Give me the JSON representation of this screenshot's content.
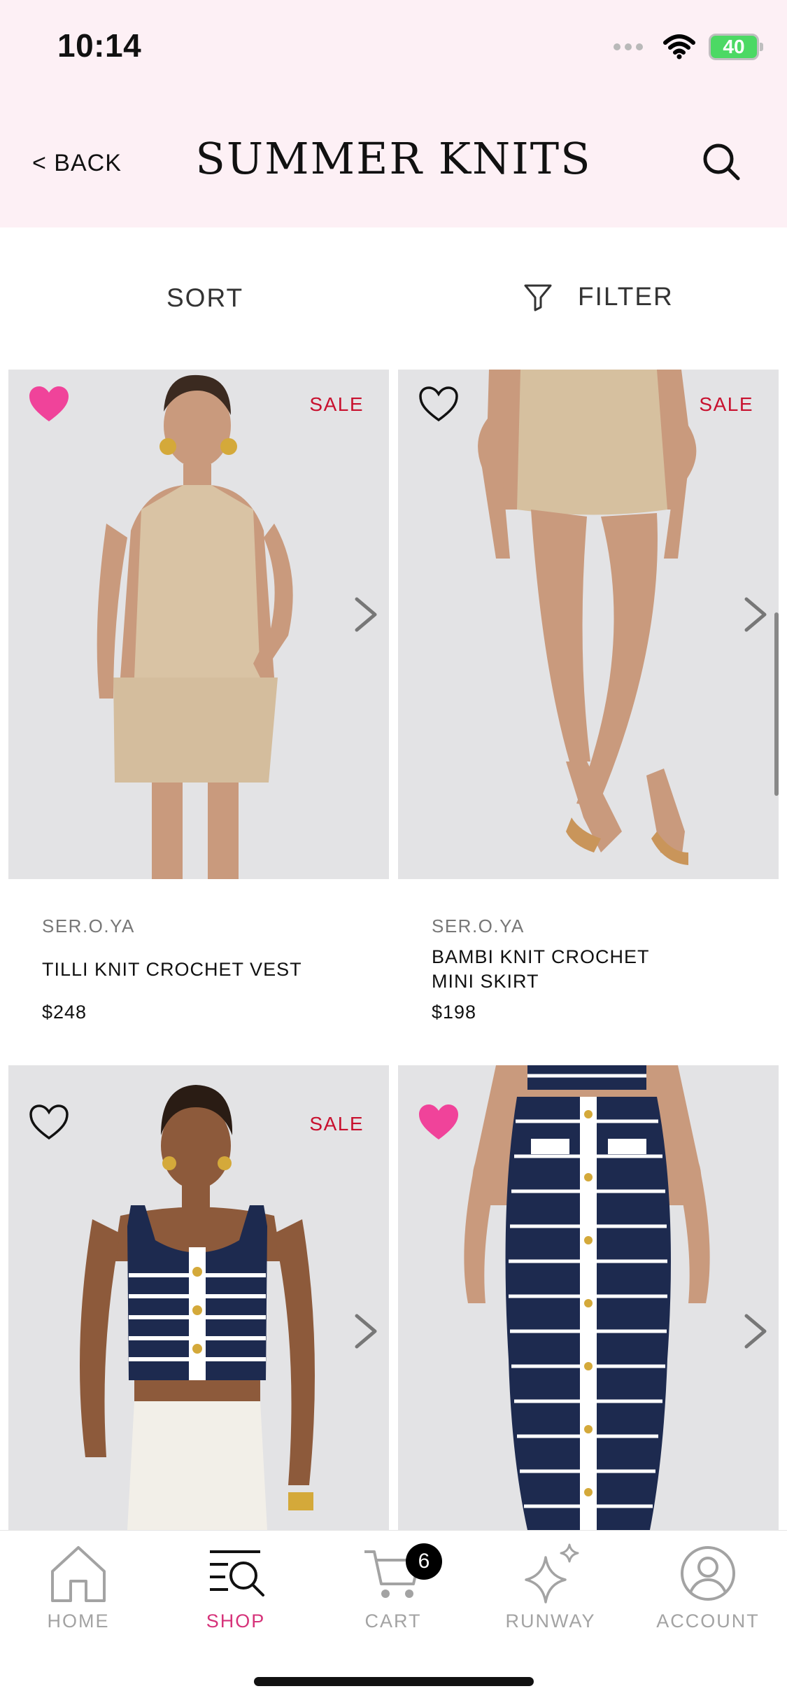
{
  "status": {
    "time": "10:14",
    "battery": "40"
  },
  "header": {
    "back_label": "< BACK",
    "title": "SUMMER KNITS"
  },
  "toolbar": {
    "sort_label": "SORT",
    "filter_label": "FILTER"
  },
  "products": [
    {
      "brand": "SER.O.YA",
      "name": "TILLI KNIT CROCHET VEST",
      "price": "$248",
      "badge": "SALE",
      "favorited": true
    },
    {
      "brand": "SER.O.YA",
      "name": "BAMBI KNIT CROCHET MINI SKIRT",
      "price": "$198",
      "badge": "SALE",
      "favorited": false
    },
    {
      "brand": "",
      "name": "",
      "price": "",
      "badge": "SALE",
      "favorited": false
    },
    {
      "brand": "",
      "name": "",
      "price": "",
      "badge": "",
      "favorited": true
    }
  ],
  "tabbar": {
    "items": [
      {
        "label": "HOME",
        "icon": "home-icon",
        "active": false
      },
      {
        "label": "SHOP",
        "icon": "shop-search-icon",
        "active": true
      },
      {
        "label": "CART",
        "icon": "cart-icon",
        "active": false,
        "badge": "6"
      },
      {
        "label": "RUNWAY",
        "icon": "sparkle-icon",
        "active": false
      },
      {
        "label": "ACCOUNT",
        "icon": "account-icon",
        "active": false
      }
    ]
  },
  "colors": {
    "header_bg": "#fdf0f5",
    "accent": "#d6337a",
    "sale": "#c8102e",
    "heart_filled": "#f0439a"
  }
}
